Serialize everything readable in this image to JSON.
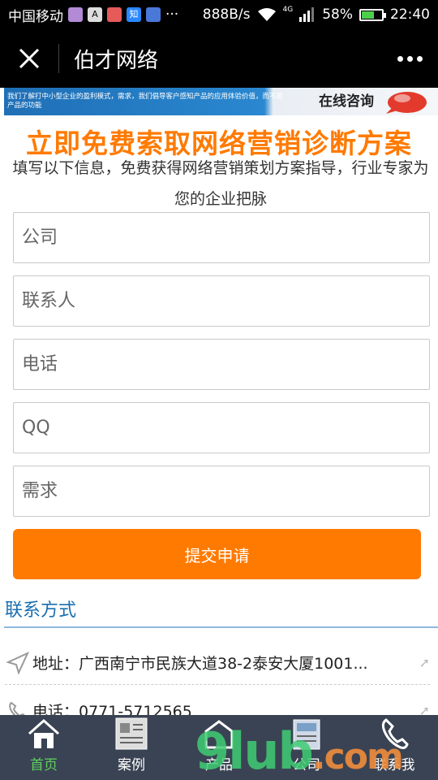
{
  "status_bar": {
    "carrier": "中国移动",
    "network_speed": "888B/s",
    "network_type": "4G",
    "battery_percent": "58%",
    "battery_level": 0.58,
    "time": "22:40",
    "ellipsis": "···"
  },
  "titlebar": {
    "title": "伯才网络"
  },
  "banner": {
    "text": "我们了解打中小型企业的盈利模式，需求，我们倡导客户感知产品的应用体验价值，而不是产品的功能",
    "cta": "在线咨询"
  },
  "headline": "立即免费索取网络营销诊断方案",
  "subline": "填写以下信息，免费获得网络营销策划方案指导，行业专家为您的企业把脉",
  "form": {
    "company_placeholder": "公司",
    "contact_placeholder": "联系人",
    "phone_placeholder": "电话",
    "qq_placeholder": "QQ",
    "needs_placeholder": "需求",
    "submit_label": "提交申请"
  },
  "contact": {
    "title": "联系方式",
    "address": "地址：广西南宁市民族大道38-2泰安大厦1001...",
    "phone": "电话：0771-5712565"
  },
  "bottom_nav": {
    "items": [
      {
        "label": "首页",
        "icon": "home-icon",
        "active": true
      },
      {
        "label": "案例",
        "icon": "cases-icon",
        "active": false
      },
      {
        "label": "产品",
        "icon": "products-icon",
        "active": false
      },
      {
        "label": "公司",
        "icon": "company-icon",
        "active": false
      },
      {
        "label": "联系我",
        "icon": "phone-icon",
        "active": false
      }
    ]
  },
  "colors": {
    "accent": "#ff7a00",
    "link": "#1a6fb0",
    "nav_bg": "#3a4353",
    "active_nav": "#5fd15f"
  },
  "watermark": {
    "text": "9lub",
    "suffix": ".com"
  }
}
